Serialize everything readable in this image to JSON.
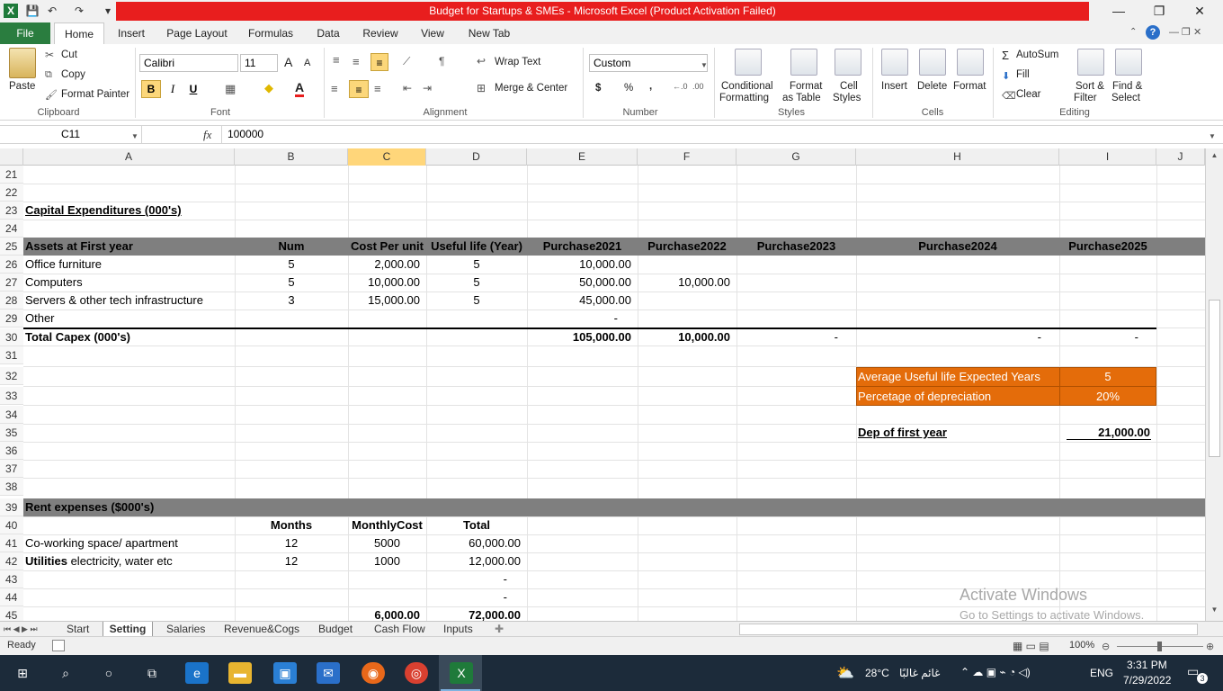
{
  "window": {
    "title": "Budget for Startups & SMEs  -  Microsoft Excel (Product Activation Failed)",
    "minimize": "—",
    "restore": "❐",
    "close": "✕"
  },
  "ribbon_tabs": [
    "File",
    "Home",
    "Insert",
    "Page Layout",
    "Formulas",
    "Data",
    "Review",
    "View",
    "New Tab"
  ],
  "clipboard": {
    "paste": "Paste",
    "cut": "Cut",
    "copy": "Copy",
    "format_painter": "Format Painter",
    "label": "Clipboard"
  },
  "font": {
    "name": "Calibri",
    "size": "11",
    "bold": "B",
    "italic": "I",
    "underline": "U",
    "label": "Font",
    "grow": "A",
    "shrink": "A"
  },
  "alignment": {
    "wrap_text": "Wrap Text",
    "merge_center": "Merge & Center",
    "label": "Alignment"
  },
  "number": {
    "format": "Custom",
    "currency": "$",
    "percent": "%",
    "comma": ",",
    "label": "Number"
  },
  "styles": {
    "conditional": "Conditional",
    "conditional2": "Formatting",
    "format_table": "Format",
    "format_table2": "as Table",
    "cell_styles": "Cell",
    "cell_styles2": "Styles",
    "label": "Styles"
  },
  "cells": {
    "insert": "Insert",
    "delete": "Delete",
    "format": "Format",
    "label": "Cells"
  },
  "editing": {
    "autosum": "AutoSum",
    "fill": "Fill",
    "clear": "Clear",
    "sort": "Sort &",
    "sort2": "Filter",
    "find": "Find &",
    "find2": "Select",
    "label": "Editing",
    "sigma": "Σ"
  },
  "formula_bar": {
    "name_box": "C11",
    "fx": "fx",
    "value": "100000"
  },
  "columns": [
    "A",
    "B",
    "C",
    "D",
    "E",
    "F",
    "G",
    "H",
    "I",
    "J"
  ],
  "rows": [
    "21",
    "22",
    "23",
    "24",
    "25",
    "26",
    "27",
    "28",
    "29",
    "30",
    "31",
    "32",
    "33",
    "34",
    "35",
    "36",
    "37",
    "38",
    "39",
    "40",
    "41",
    "42",
    "43",
    "44",
    "45"
  ],
  "capex": {
    "title": "Capital Expenditures (000's)",
    "headers": [
      "Assets at First year",
      "Num",
      "Cost Per unit",
      "Useful life (Year)",
      "Purchase2021",
      "Purchase2022",
      "Purchase2023",
      "Purchase2024",
      "Purchase2025"
    ],
    "items": [
      {
        "name": "Office furniture",
        "num": "5",
        "cost": "2,000.00",
        "life": "5",
        "p2021": "10,000.00",
        "p2022": ""
      },
      {
        "name": "Computers",
        "num": "5",
        "cost": "10,000.00",
        "life": "5",
        "p2021": "50,000.00",
        "p2022": "10,000.00"
      },
      {
        "name": "Servers & other tech infrastructure",
        "num": "3",
        "cost": "15,000.00",
        "life": "5",
        "p2021": "45,000.00",
        "p2022": ""
      },
      {
        "name": "Other",
        "num": "",
        "cost": "",
        "life": "",
        "p2021": "-",
        "p2022": ""
      }
    ],
    "total_label": "Total Capex (000's)",
    "total": {
      "p2021": "105,000.00",
      "p2022": "10,000.00",
      "p2023": "-",
      "p2024": "-",
      "p2025": "-"
    }
  },
  "depreciation": {
    "avg_life_label": "Average Useful life Expected Years",
    "avg_life_value": "5",
    "pct_label": "Percetage of depreciation",
    "pct_value": "20%",
    "dep_label": "Dep of first year",
    "dep_value": "21,000.00"
  },
  "rent": {
    "title": "Rent expenses ($000's)",
    "headers": [
      "Months",
      "MonthlyCost",
      "Total"
    ],
    "items": [
      {
        "name": "Co-working space/ apartment",
        "bold_prefix": "",
        "months": "12",
        "cost": "5000",
        "total": "60,000.00"
      },
      {
        "name": " electricity, water etc",
        "bold_prefix": "Utilities",
        "months": "12",
        "cost": "1000",
        "total": "12,000.00"
      }
    ],
    "dash1": "-",
    "dash2": "-",
    "sum_cost": "6,000.00",
    "sum_total": "72,000.00"
  },
  "sheet_tabs": [
    "Start",
    "Setting",
    "Salaries",
    "Revenue&Cogs",
    "Budget",
    "Cash Flow",
    "Inputs"
  ],
  "status": {
    "ready": "Ready",
    "zoom": "100%",
    "activate1": "Activate Windows",
    "activate2": "Go to Settings to activate Windows."
  },
  "taskbar": {
    "weather": "28°C",
    "weather_text": "غائم غالبًا",
    "lang": "ENG",
    "time": "3:31 PM",
    "date": "7/29/2022",
    "notif": "3"
  },
  "colors": {
    "header_gray": "#7f7f7f",
    "orange": "#e46c0a",
    "excel_green": "#2a7d3f",
    "title_red": "#e81e1e"
  }
}
